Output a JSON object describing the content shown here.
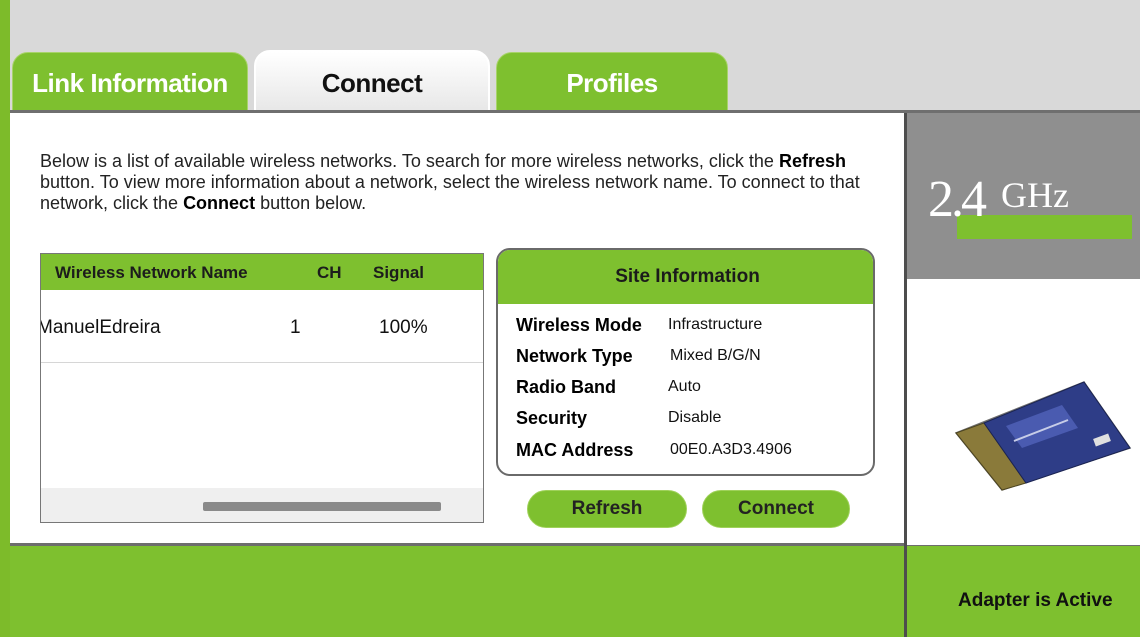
{
  "tabs": [
    {
      "label": "Link Information"
    },
    {
      "label": "Connect"
    },
    {
      "label": "Profiles"
    }
  ],
  "intro": {
    "part1": "Below is a list of available wireless networks. To search for more wireless networks, click the ",
    "refresh_word": "Refresh",
    "part2": " button. To view more information about a network, select the wireless network name. To connect to that network, click the ",
    "connect_word": "Connect",
    "part3": " button below."
  },
  "network_list": {
    "columns": [
      "Wireless Network Name",
      "CH",
      "Signal"
    ],
    "rows": [
      {
        "name": "ManuelEdreira",
        "channel": "1",
        "signal": "100%"
      }
    ]
  },
  "site_info": {
    "title": "Site Information",
    "fields": [
      {
        "label": "Wireless Mode",
        "value": "Infrastructure"
      },
      {
        "label": "Network Type",
        "value": "Mixed B/G/N"
      },
      {
        "label": "Radio Band",
        "value": "Auto"
      },
      {
        "label": "Security",
        "value": "Disable"
      },
      {
        "label": "MAC Address",
        "value": "00E0.A3D3.4906"
      }
    ]
  },
  "buttons": {
    "refresh": "Refresh",
    "connect": "Connect"
  },
  "band_badge": {
    "number": "2.4",
    "unit": "GHz"
  },
  "status": {
    "text": "Adapter is Active"
  },
  "colors": {
    "accent_green": "#7ec02f",
    "top_gray": "#d9d9d9",
    "side_gray": "#8f8f8f"
  }
}
